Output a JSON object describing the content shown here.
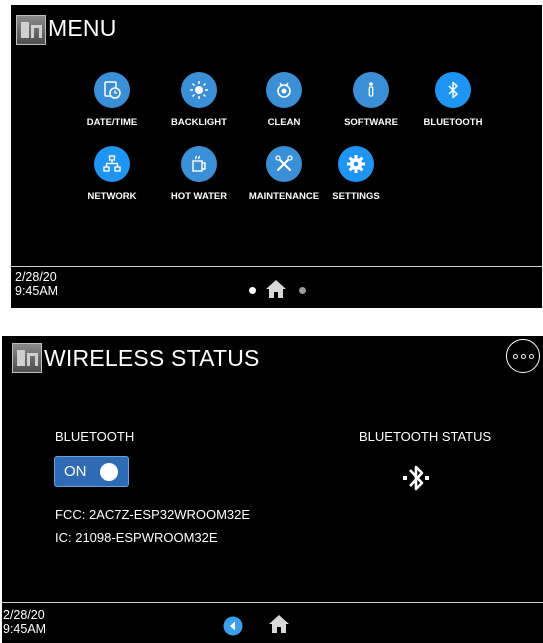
{
  "menu_screen": {
    "title": "MENU",
    "items": [
      {
        "label": "DATE/TIME",
        "icon": "clock-icon"
      },
      {
        "label": "BACKLIGHT",
        "icon": "sun-icon"
      },
      {
        "label": "CLEAN",
        "icon": "clean-icon"
      },
      {
        "label": "SOFTWARE",
        "icon": "info-icon"
      },
      {
        "label": "BLUETOOTH",
        "icon": "bluetooth-icon"
      },
      {
        "label": "NETWORK",
        "icon": "network-icon"
      },
      {
        "label": "HOT WATER",
        "icon": "hot-water-icon"
      },
      {
        "label": "MAINTENANCE",
        "icon": "wrench-icon"
      },
      {
        "label": "SETTINGS",
        "icon": "gear-icon"
      }
    ],
    "date": "2/28/20",
    "time": "9:45AM"
  },
  "wireless_screen": {
    "title": "WIRELESS STATUS",
    "bluetooth_label": "BLUETOOTH",
    "toggle_label": "ON",
    "toggle_on": true,
    "status_label": "BLUETOOTH STATUS",
    "fcc": "FCC: 2AC7Z-ESP32WROOM32E",
    "ic": "IC: 21098-ESPWROOM32E",
    "date": "2/28/20",
    "time": "9:45AM"
  },
  "colors": {
    "background": "#000000",
    "icon_blue": "#3a8fd6",
    "active_blue": "#1e95f2",
    "toggle_blue": "#2f6bb5"
  }
}
